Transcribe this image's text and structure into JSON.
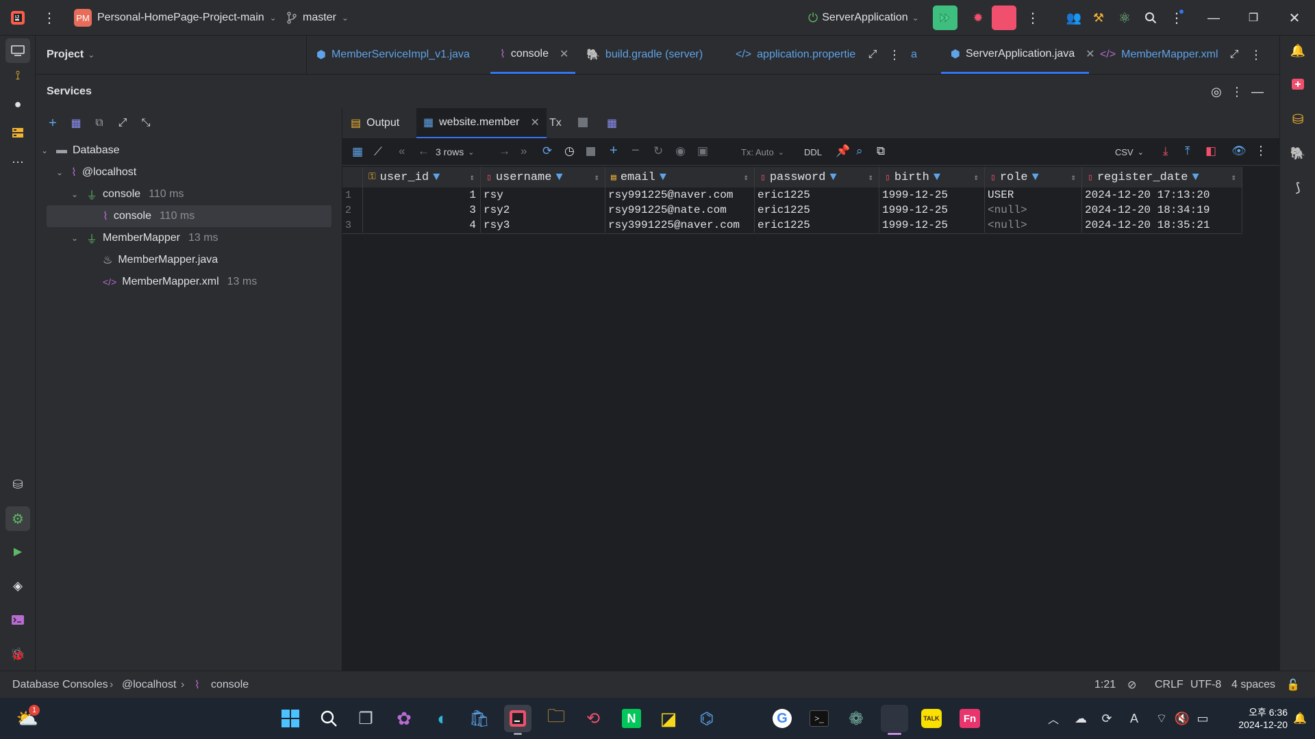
{
  "titlebar": {
    "project_badge": "PM",
    "project_name": "Personal-HomePage-Project-main",
    "branch": "master",
    "run_config": "ServerApplication"
  },
  "project_panel": {
    "title": "Project"
  },
  "editor_tabs": [
    {
      "label": "MemberServiceImpl_v1.java"
    },
    {
      "label": "console"
    },
    {
      "label": "build.gradle (server)"
    },
    {
      "label": "application.propertie"
    },
    {
      "label": "a"
    },
    {
      "label": "ServerApplication.java"
    },
    {
      "label": "MemberMapper.xml"
    }
  ],
  "services": {
    "title": "Services"
  },
  "tree": {
    "database": "Database",
    "localhost": "@localhost",
    "console_group": "console",
    "console_group_ms": "110 ms",
    "console_item": "console",
    "console_item_ms": "110 ms",
    "mapper_group": "MemberMapper",
    "mapper_group_ms": "13 ms",
    "mapper_java": "MemberMapper.java",
    "mapper_xml": "MemberMapper.xml",
    "mapper_xml_ms": "13 ms"
  },
  "result_tabs": {
    "output": "Output",
    "table": "website.member",
    "tx": "Tx"
  },
  "toolbar": {
    "rows": "3 rows",
    "tx_mode": "Tx: Auto",
    "ddl": "DDL",
    "export_format": "CSV"
  },
  "grid": {
    "columns": [
      "user_id",
      "username",
      "email",
      "password",
      "birth",
      "role",
      "register_date"
    ],
    "rows": [
      {
        "num": "1",
        "user_id": "1",
        "username": "rsy",
        "email": "rsy991225@naver.com",
        "password": "eric1225",
        "birth": "1999-12-25",
        "role": "USER",
        "register_date": "2024-12-20 17:13:20"
      },
      {
        "num": "2",
        "user_id": "3",
        "username": "rsy2",
        "email": "rsy991225@nate.com",
        "password": "eric1225",
        "birth": "1999-12-25",
        "role": "<null>",
        "register_date": "2024-12-20 18:34:19"
      },
      {
        "num": "3",
        "user_id": "4",
        "username": "rsy3",
        "email": "rsy3991225@naver.com",
        "password": "eric1225",
        "birth": "1999-12-25",
        "role": "<null>",
        "register_date": "2024-12-20 18:35:21"
      }
    ]
  },
  "statusbar": {
    "crumb1": "Database Consoles",
    "crumb2": "@localhost",
    "crumb3": "console",
    "position": "1:21",
    "line_sep": "CRLF",
    "encoding": "UTF-8",
    "indent": "4 spaces"
  },
  "taskbar": {
    "weather_badge": "1",
    "time": "오후 6:36",
    "date": "2024-12-20",
    "talk": "TALK",
    "fn": "Fn"
  },
  "colors": {
    "accent": "#3574f0",
    "run_green": "#3fbf7f",
    "stop_red": "#f0506e"
  }
}
